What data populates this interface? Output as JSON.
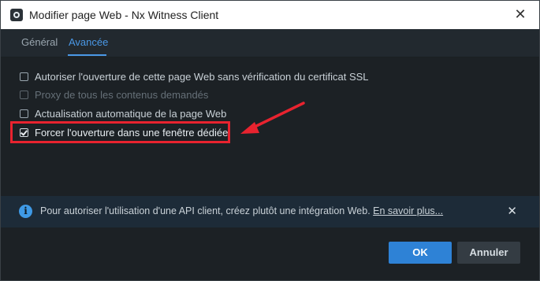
{
  "window": {
    "title": "Modifier page Web - Nx Witness Client",
    "close_glyph": "✕"
  },
  "tabs": [
    {
      "label": "Général",
      "active": false
    },
    {
      "label": "Avancée",
      "active": true
    }
  ],
  "options": [
    {
      "label": "Autoriser l'ouverture de cette page Web sans vérification du certificat SSL",
      "checked": false,
      "enabled": true
    },
    {
      "label": "Proxy de tous les contenus demandés",
      "checked": false,
      "enabled": false
    },
    {
      "label": "Actualisation automatique de la page Web",
      "checked": false,
      "enabled": true
    },
    {
      "label": "Forcer l'ouverture dans une fenêtre dédiée",
      "checked": true,
      "enabled": true
    }
  ],
  "info": {
    "icon": "info-icon",
    "text": "Pour autoriser l'utilisation d'une API client, créez plutôt une intégration Web. ",
    "link": "En savoir plus...",
    "close_glyph": "✕"
  },
  "buttons": {
    "ok": "OK",
    "cancel": "Annuler"
  },
  "colors": {
    "accent": "#2e82d6",
    "tab_active": "#4a98e6",
    "highlight": "#e8232f",
    "background": "#1c2125"
  }
}
